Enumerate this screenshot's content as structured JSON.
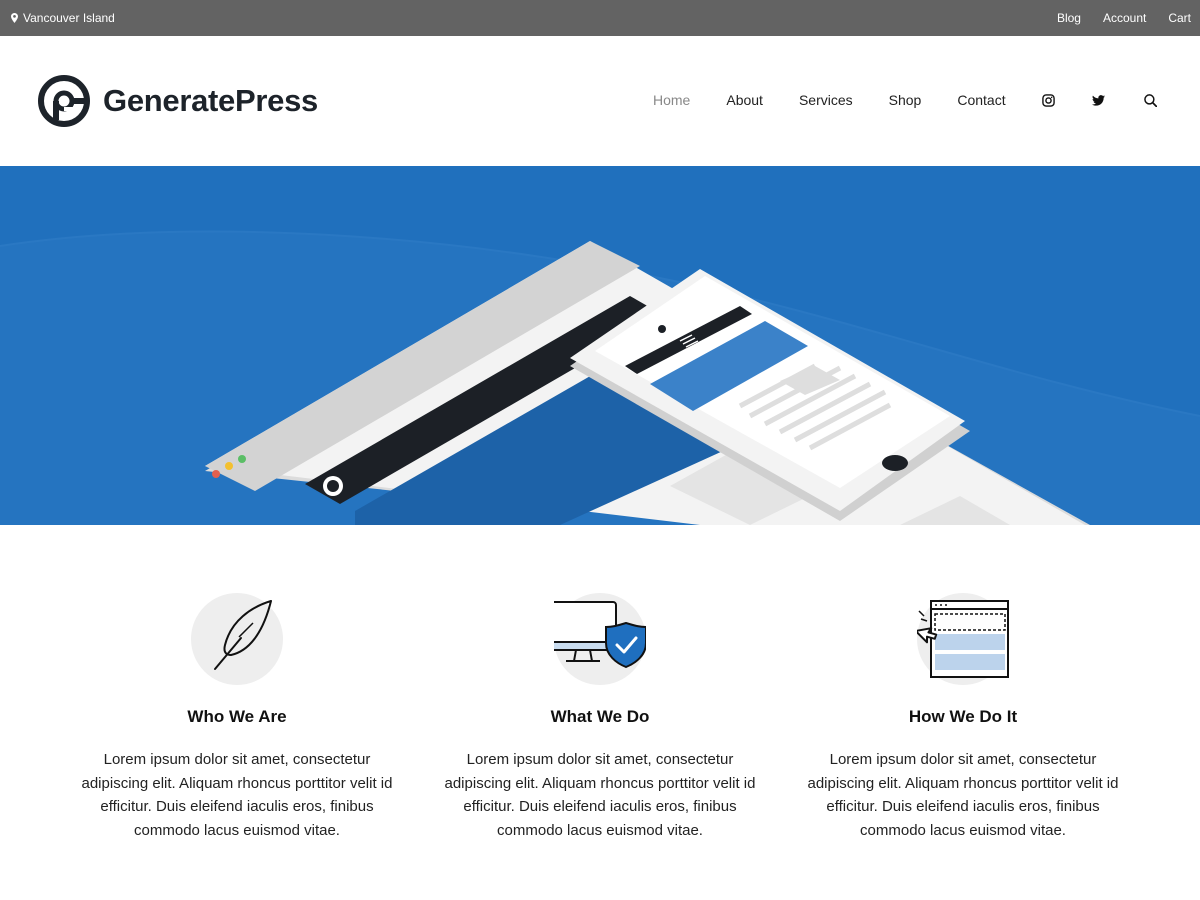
{
  "topbar": {
    "location": "Vancouver Island",
    "links": [
      "Blog",
      "Account",
      "Cart"
    ]
  },
  "header": {
    "brand": "GeneratePress",
    "nav": [
      {
        "label": "Home",
        "active": true
      },
      {
        "label": "About",
        "active": false
      },
      {
        "label": "Services",
        "active": false
      },
      {
        "label": "Shop",
        "active": false
      },
      {
        "label": "Contact",
        "active": false
      }
    ],
    "icons": [
      "instagram-icon",
      "twitter-icon",
      "search-icon"
    ]
  },
  "hero": {
    "background_color": "#2070bd"
  },
  "features": [
    {
      "icon": "feather-icon",
      "title": "Who We Are",
      "text": "Lorem ipsum dolor sit amet, consectetur adipiscing elit. Aliquam rhoncus porttitor velit id efficitur. Duis eleifend iaculis eros, finibus commodo lacus euismod vitae."
    },
    {
      "icon": "monitor-shield-icon",
      "title": "What We Do",
      "text": "Lorem ipsum dolor sit amet, consectetur adipiscing elit. Aliquam rhoncus porttitor velit id efficitur. Duis eleifend iaculis eros, finibus commodo lacus euismod vitae."
    },
    {
      "icon": "browser-cursor-icon",
      "title": "How We Do It",
      "text": "Lorem ipsum dolor sit amet, consectetur adipiscing elit. Aliquam rhoncus porttitor velit id efficitur. Duis eleifend iaculis eros, finibus commodo lacus euismod vitae."
    }
  ],
  "colors": {
    "topbar": "#636363",
    "brand_text": "#1d232a",
    "accent_blue": "#2070bd",
    "icon_circle": "#eeeeee"
  }
}
